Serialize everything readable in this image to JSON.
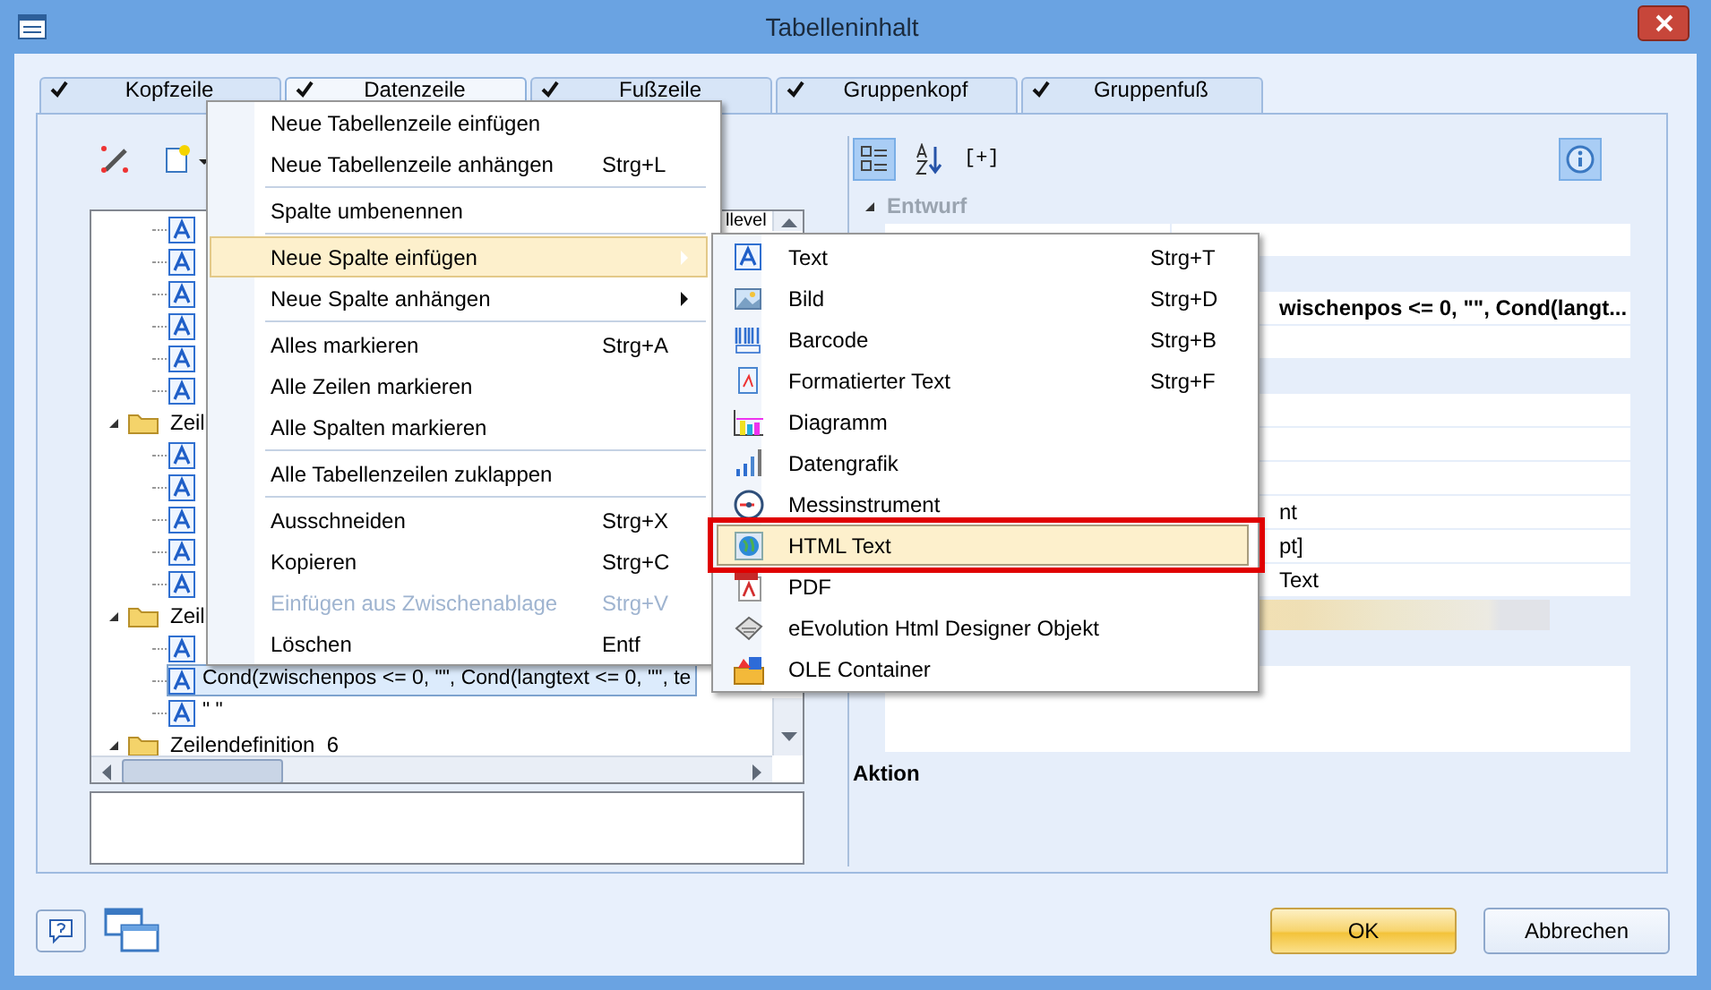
{
  "window": {
    "title": "Tabelleninhalt"
  },
  "tabs": [
    {
      "label": "Kopfzeile",
      "checked": true,
      "selected": false
    },
    {
      "label": "Datenzeile",
      "checked": true,
      "selected": true
    },
    {
      "label": "Fußzeile",
      "checked": true,
      "selected": false
    },
    {
      "label": "Gruppenkopf",
      "checked": true,
      "selected": false
    },
    {
      "label": "Gruppenfuß",
      "checked": true,
      "selected": false
    }
  ],
  "tree": {
    "column_header": "llevel",
    "items": [
      {
        "kind": "continued",
        "children": [
          {
            "kind": "field",
            "selected": false
          },
          {
            "kind": "field",
            "selected": false
          },
          {
            "kind": "field",
            "selected": false
          },
          {
            "kind": "field",
            "selected": false
          },
          {
            "kind": "field",
            "selected": false
          },
          {
            "kind": "field",
            "selected": false
          }
        ]
      },
      {
        "kind": "folder",
        "label": "Zeil",
        "expanded": true,
        "children": [
          {
            "kind": "field",
            "selected": false
          },
          {
            "kind": "field",
            "selected": false
          },
          {
            "kind": "field",
            "selected": false
          },
          {
            "kind": "field",
            "selected": false
          },
          {
            "kind": "field",
            "selected": false
          }
        ]
      },
      {
        "kind": "folder",
        "label": "Zeil",
        "expanded": true,
        "children": [
          {
            "kind": "field",
            "selected": false
          },
          {
            "kind": "field",
            "label": "Cond(zwischenpos <= 0, \"\", Cond(langtext <= 0, \"\", te",
            "selected": true
          },
          {
            "kind": "field",
            "label": "\" \"",
            "selected": false
          }
        ]
      },
      {
        "kind": "folder",
        "label": "Zeilendefinition  6",
        "expanded": true
      }
    ]
  },
  "properties": {
    "expand_all": "[+]",
    "category": "Entwurf",
    "rows": [
      {
        "kind": "row"
      },
      {
        "kind": "gap"
      },
      {
        "kind": "bold",
        "value": "wischenpos <= 0, \"\", Cond(langt..."
      },
      {
        "kind": "row"
      },
      {
        "kind": "gap"
      },
      {
        "kind": "row"
      },
      {
        "kind": "row"
      },
      {
        "kind": "row"
      },
      {
        "kind": "row",
        "value": "nt"
      },
      {
        "kind": "row",
        "value": "pt]"
      },
      {
        "kind": "row",
        "value": "Text"
      },
      {
        "kind": "swatch"
      },
      {
        "kind": "gap"
      },
      {
        "kind": "tall"
      }
    ],
    "description_title": "Aktion"
  },
  "context_menu": [
    {
      "kind": "item",
      "label": "Neue Tabellenzeile einfügen",
      "selected": false,
      "disabled": false,
      "has_submenu": false
    },
    {
      "kind": "item",
      "label": "Neue Tabellenzeile anhängen",
      "shortcut": "Strg+L",
      "selected": false,
      "disabled": false,
      "has_submenu": false
    },
    {
      "kind": "separator"
    },
    {
      "kind": "item",
      "label": "Spalte umbenennen",
      "selected": false,
      "disabled": false,
      "has_submenu": false
    },
    {
      "kind": "separator"
    },
    {
      "kind": "item",
      "label": "Neue Spalte einfügen",
      "selected": true,
      "disabled": false,
      "has_submenu": true
    },
    {
      "kind": "item",
      "label": "Neue Spalte anhängen",
      "selected": false,
      "disabled": false,
      "has_submenu": true
    },
    {
      "kind": "separator"
    },
    {
      "kind": "item",
      "label": "Alles markieren",
      "shortcut": "Strg+A",
      "selected": false,
      "disabled": false,
      "has_submenu": false
    },
    {
      "kind": "item",
      "label": "Alle Zeilen markieren",
      "selected": false,
      "disabled": false,
      "has_submenu": false
    },
    {
      "kind": "item",
      "label": "Alle Spalten markieren",
      "selected": false,
      "disabled": false,
      "has_submenu": false
    },
    {
      "kind": "separator"
    },
    {
      "kind": "item",
      "label": "Alle Tabellenzeilen zuklappen",
      "selected": false,
      "disabled": false,
      "has_submenu": false
    },
    {
      "kind": "separator"
    },
    {
      "kind": "item",
      "label": "Ausschneiden",
      "shortcut": "Strg+X",
      "selected": false,
      "disabled": false,
      "has_submenu": false
    },
    {
      "kind": "item",
      "label": "Kopieren",
      "shortcut": "Strg+C",
      "selected": false,
      "disabled": false,
      "has_submenu": false
    },
    {
      "kind": "item",
      "label": "Einfügen aus Zwischenablage",
      "shortcut": "Strg+V",
      "selected": false,
      "disabled": true,
      "has_submenu": false
    },
    {
      "kind": "item",
      "label": "Löschen",
      "shortcut": "Entf",
      "selected": false,
      "disabled": false,
      "has_submenu": false
    }
  ],
  "submenu": [
    {
      "kind": "text",
      "label": "Text",
      "shortcut": "Strg+T",
      "selected": false,
      "outlined": false
    },
    {
      "kind": "image",
      "label": "Bild",
      "shortcut": "Strg+D",
      "selected": false,
      "outlined": false
    },
    {
      "kind": "barcode",
      "label": "Barcode",
      "shortcut": "Strg+B",
      "selected": false,
      "outlined": false
    },
    {
      "kind": "formatted",
      "label": "Formatierter Text",
      "shortcut": "Strg+F",
      "selected": false,
      "outlined": false
    },
    {
      "kind": "chart",
      "label": "Diagramm",
      "selected": false,
      "outlined": false
    },
    {
      "kind": "datagraphic",
      "label": "Datengrafik",
      "selected": false,
      "outlined": false
    },
    {
      "kind": "gauge",
      "label": "Messinstrument",
      "selected": false,
      "outlined": false
    },
    {
      "kind": "html",
      "label": "HTML Text",
      "selected": true,
      "outlined": true
    },
    {
      "kind": "pdf",
      "label": "PDF",
      "selected": false,
      "outlined": false
    },
    {
      "kind": "designer",
      "label": "eEvolution Html Designer Objekt",
      "selected": false,
      "outlined": false
    },
    {
      "kind": "ole",
      "label": "OLE Container",
      "selected": false,
      "outlined": false
    }
  ],
  "buttons": [
    {
      "kind": "ok",
      "label": "OK"
    },
    {
      "kind": "cancel",
      "label": "Abbrechen"
    }
  ]
}
